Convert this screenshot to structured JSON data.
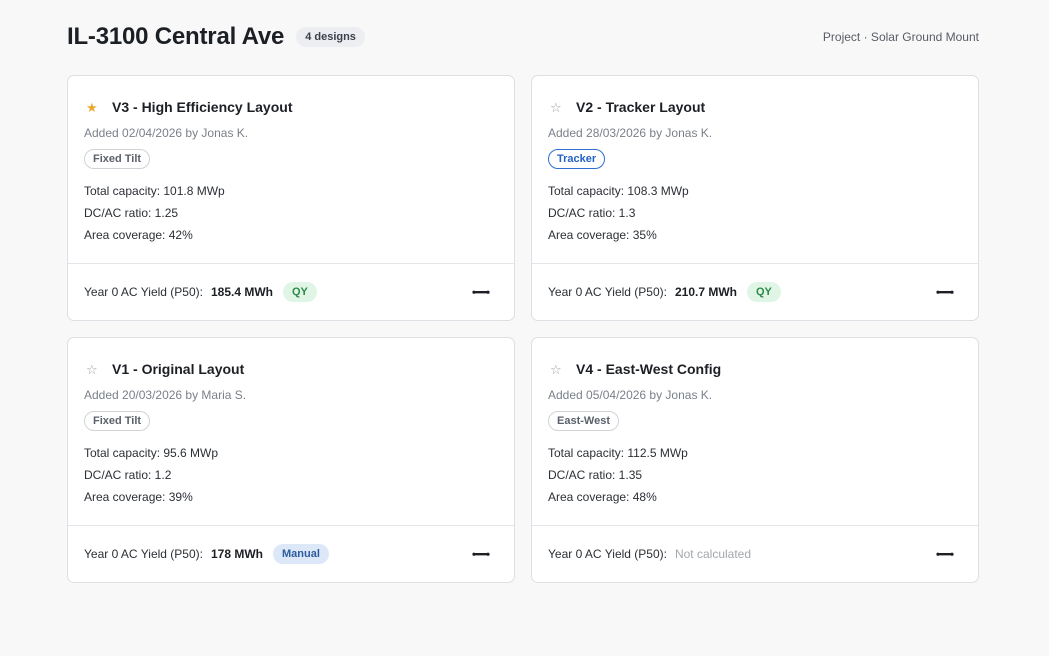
{
  "header": {
    "title": "IL-3100 Central Ave",
    "count_badge": "4 designs",
    "project_label": "Project · Solar Ground Mount"
  },
  "cards": [
    {
      "star": "★",
      "favorite": true,
      "title": "V3 - High Efficiency Layout",
      "added": "Added 02/04/2026 by Jonas K.",
      "tag": "Fixed Tilt",
      "capacity": "Total capacity: 101.8 MWp",
      "dcac": "DC/AC ratio: 1.25",
      "area": "Area coverage: 42%",
      "yield_label": "Year 0 AC Yield (P50):",
      "yield_value": "185.4 MWh",
      "yield_badge": "QY",
      "menu_icon": "more-horizontal-icon"
    },
    {
      "star": "☆",
      "favorite": false,
      "title": "V2 - Tracker Layout",
      "added": "Added 28/03/2026 by Jonas K.",
      "tag": "Tracker",
      "capacity": "Total capacity: 108.3 MWp",
      "dcac": "DC/AC ratio: 1.3",
      "area": "Area coverage: 35%",
      "yield_label": "Year 0 AC Yield (P50):",
      "yield_value": "210.7 MWh",
      "yield_badge": "QY",
      "menu_icon": "more-horizontal-icon"
    },
    {
      "star": "☆",
      "favorite": false,
      "title": "V1 - Original Layout",
      "added": "Added 20/03/2026 by Maria S.",
      "tag": "Fixed Tilt",
      "capacity": "Total capacity: 95.6 MWp",
      "dcac": "DC/AC ratio: 1.2",
      "area": "Area coverage: 39%",
      "yield_label": "Year 0 AC Yield (P50):",
      "yield_value": "178 MWh",
      "yield_badge": "Manual",
      "menu_icon": "more-horizontal-icon"
    },
    {
      "star": "☆",
      "favorite": false,
      "title": "V4 - East-West Config",
      "added": "Added 05/04/2026 by Jonas K.",
      "tag": "East-West",
      "capacity": "Total capacity: 112.5 MWp",
      "dcac": "DC/AC ratio: 1.35",
      "area": "Area coverage: 48%",
      "yield_label": "Year 0 AC Yield (P50):",
      "yield_value": "Not calculated",
      "menu_icon": "more-horizontal-icon"
    }
  ],
  "colors": {
    "star_favorite": "#e8a92c",
    "tracker_tag": "#2f6fd1",
    "qy_badge_bg": "#e1f5e6",
    "manual_badge_bg": "#dce8f8"
  }
}
